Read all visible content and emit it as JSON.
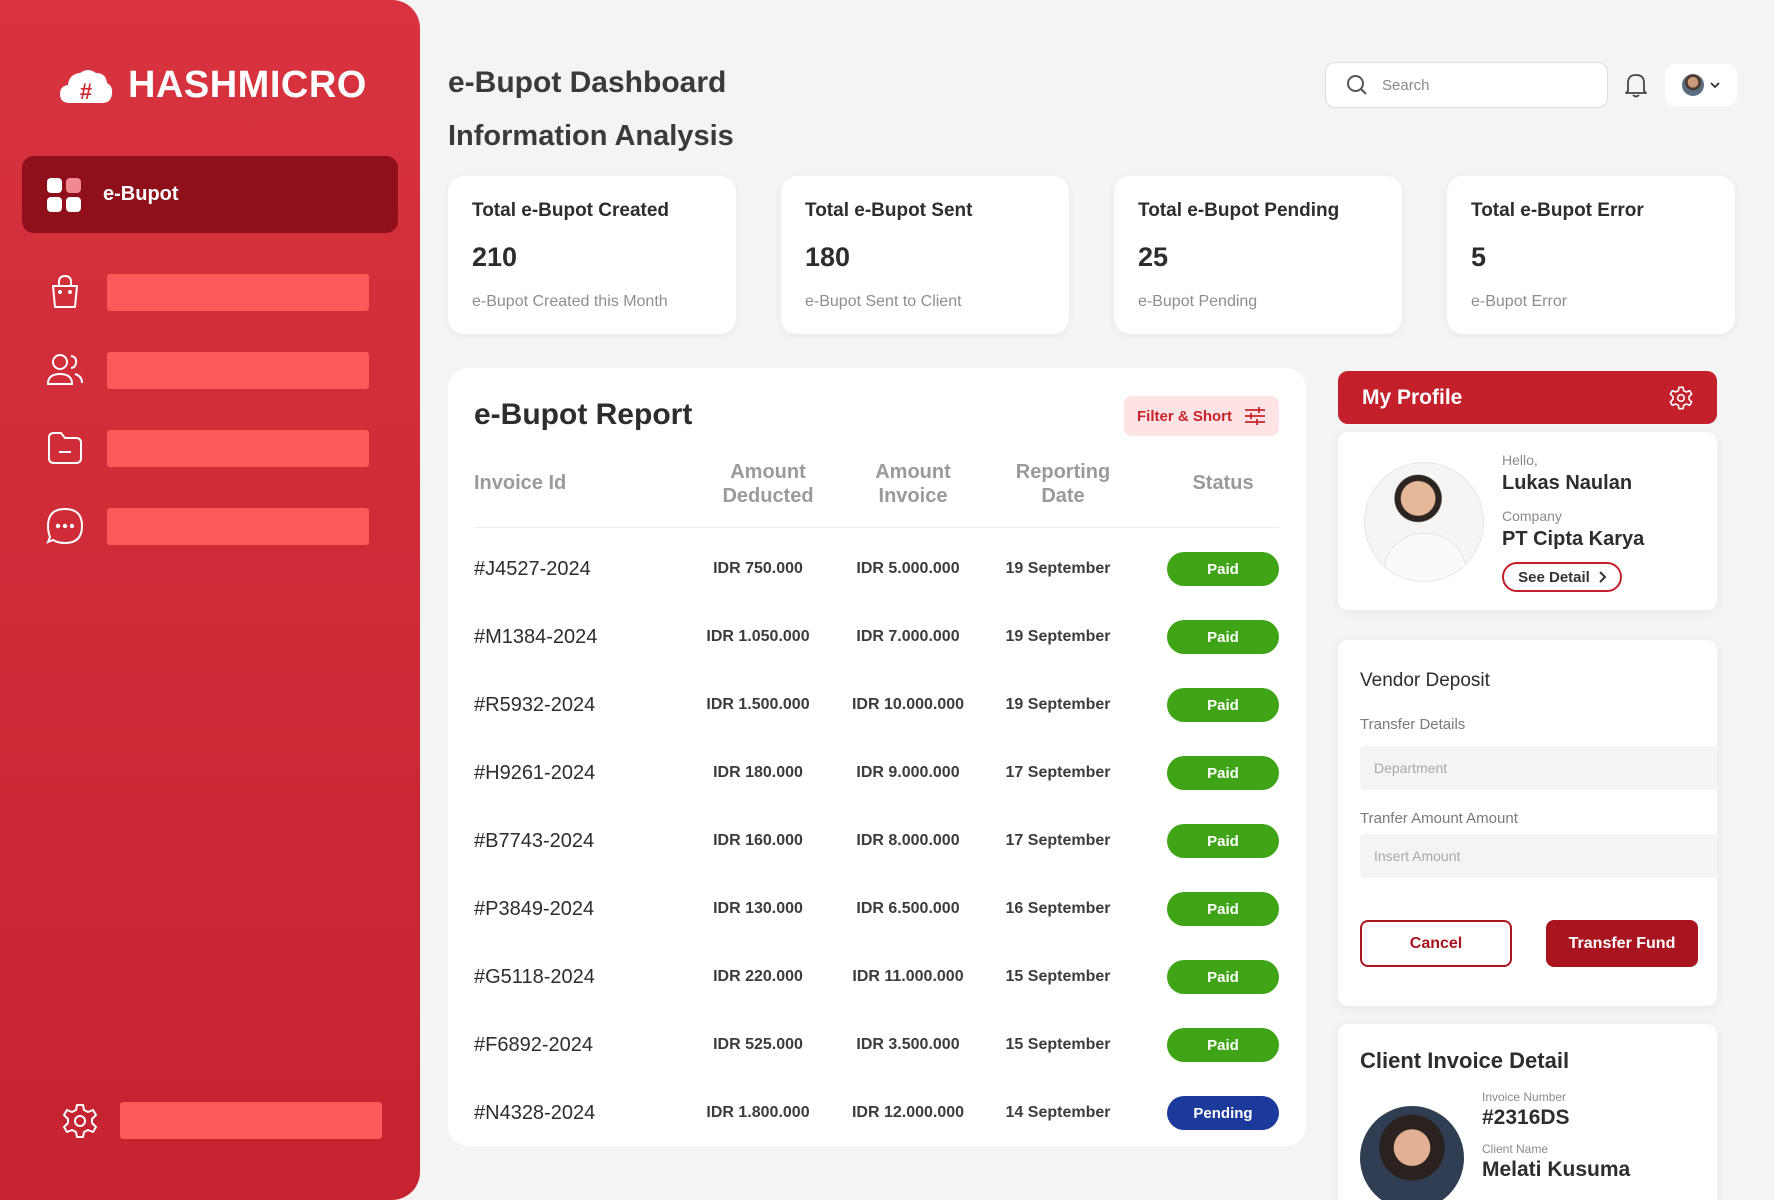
{
  "brand": {
    "name": "HASHMICRO"
  },
  "sidebar": {
    "active_label": "e-Bupot",
    "items": [
      {
        "icon": "shopping-bag-icon"
      },
      {
        "icon": "users-icon"
      },
      {
        "icon": "folder-icon"
      },
      {
        "icon": "chat-icon"
      }
    ],
    "settings_icon": "gear-icon"
  },
  "header": {
    "title": "e-Bupot Dashboard",
    "section": "Information Analysis",
    "search_placeholder": "Search"
  },
  "stats": [
    {
      "title": "Total e-Bupot Created",
      "value": "210",
      "sub": "e-Bupot Created this Month"
    },
    {
      "title": "Total e-Bupot Sent",
      "value": "180",
      "sub": "e-Bupot Sent to Client"
    },
    {
      "title": "Total e-Bupot Pending",
      "value": "25",
      "sub": "e-Bupot Pending"
    },
    {
      "title": "Total e-Bupot Error",
      "value": "5",
      "sub": "e-Bupot Error"
    }
  ],
  "report": {
    "title": "e-Bupot Report",
    "filter_label": "Filter & Short",
    "columns": [
      "Invoice Id",
      "Amount Deducted",
      "Amount Invoice",
      "Reporting Date",
      "Status"
    ],
    "rows": [
      {
        "id": "#J4527-2024",
        "deducted": "IDR 750.000",
        "invoice": "IDR 5.000.000",
        "date": "19 September",
        "status": "Paid"
      },
      {
        "id": "#M1384-2024",
        "deducted": "IDR 1.050.000",
        "invoice": "IDR 7.000.000",
        "date": "19 September",
        "status": "Paid"
      },
      {
        "id": "#R5932-2024",
        "deducted": "IDR 1.500.000",
        "invoice": "IDR 10.000.000",
        "date": "19 September",
        "status": "Paid"
      },
      {
        "id": "#H9261-2024",
        "deducted": "IDR 180.000",
        "invoice": "IDR 9.000.000",
        "date": "17 September",
        "status": "Paid"
      },
      {
        "id": "#B7743-2024",
        "deducted": "IDR 160.000",
        "invoice": "IDR 8.000.000",
        "date": "17 September",
        "status": "Paid"
      },
      {
        "id": "#P3849-2024",
        "deducted": "IDR 130.000",
        "invoice": "IDR 6.500.000",
        "date": "16 September",
        "status": "Paid"
      },
      {
        "id": "#G5118-2024",
        "deducted": "IDR 220.000",
        "invoice": "IDR 11.000.000",
        "date": "15 September",
        "status": "Paid"
      },
      {
        "id": "#F6892-2024",
        "deducted": "IDR 525.000",
        "invoice": "IDR 3.500.000",
        "date": "15 September",
        "status": "Paid"
      },
      {
        "id": "#N4328-2024",
        "deducted": "IDR 1.800.000",
        "invoice": "IDR 12.000.000",
        "date": "14 September",
        "status": "Pending"
      }
    ],
    "status_colors": {
      "Paid": "#3fa516",
      "Pending": "#1c3a9c"
    }
  },
  "profile": {
    "title": "My Profile",
    "greeting": "Hello,",
    "name": "Lukas Naulan",
    "company_label": "Company",
    "company": "PT Cipta Karya",
    "see_detail": "See Detail"
  },
  "vendor": {
    "title": "Vendor Deposit",
    "transfer_label": "Transfer Details",
    "department_placeholder": "Department",
    "amount_label": "Tranfer Amount Amount",
    "amount_placeholder": "Insert Amount",
    "cancel": "Cancel",
    "transfer": "Transfer Fund"
  },
  "client": {
    "title": "Client Invoice Detail",
    "invoice_label": "Invoice Number",
    "invoice": "#2316DS",
    "name_label": "Client Name",
    "name": "Melati Kusuma"
  }
}
